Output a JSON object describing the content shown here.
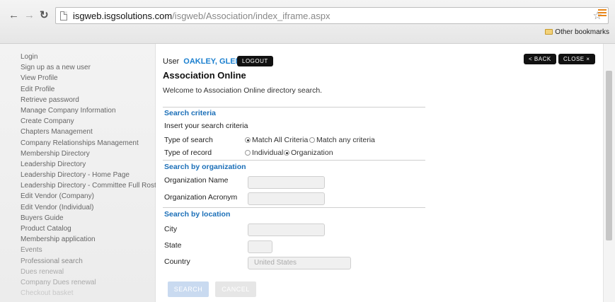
{
  "browser": {
    "url_host": "isgweb.isgsolutions.com",
    "url_path": "/isgweb/Association/index_iframe.aspx",
    "bookmarks_label": "Other bookmarks",
    "icons": {
      "back": "back-arrow-icon",
      "forward": "forward-arrow-icon",
      "reload": "reload-icon",
      "page": "page-icon",
      "star": "star-icon",
      "menu": "menu-icon",
      "folder": "folder-icon"
    }
  },
  "sidebar": {
    "items": [
      {
        "label": "Login"
      },
      {
        "label": "Sign up as a new user"
      },
      {
        "label": "View Profile"
      },
      {
        "label": "Edit Profile"
      },
      {
        "label": "Retrieve password"
      },
      {
        "label": "Manage Company Information"
      },
      {
        "label": "Create Company"
      },
      {
        "label": "Chapters Management"
      },
      {
        "label": "Company Relationships Management"
      },
      {
        "label": "Membership Directory"
      },
      {
        "label": "Leadership Directory"
      },
      {
        "label": "Leadership Directory - Home Page"
      },
      {
        "label": "Leadership Directory - Committee Full Roster"
      },
      {
        "label": "Edit Vendor (Company)"
      },
      {
        "label": "Edit Vendor (Individual)"
      },
      {
        "label": "Buyers Guide"
      },
      {
        "label": "Product Catalog"
      },
      {
        "label": "Membership application"
      },
      {
        "label": "Events"
      },
      {
        "label": "Professional search"
      },
      {
        "label": "Dues renewal"
      },
      {
        "label": "Company Dues renewal"
      },
      {
        "label": "Checkout basket"
      }
    ]
  },
  "header": {
    "user_prefix": "User",
    "user_name": "OAKLEY, GLEN",
    "logout_label": "LOGOUT",
    "back_label": "< BACK",
    "close_label": "CLOSE ×"
  },
  "page": {
    "title": "Association Online",
    "welcome": "Welcome to Association Online directory search."
  },
  "search_criteria": {
    "heading": "Search criteria",
    "instruction": "Insert your search criteria",
    "type_of_search_label": "Type of search",
    "type_of_search_options": [
      "Match All Criteria",
      "Match any criteria"
    ],
    "type_of_search_selected": "Match All Criteria",
    "type_of_record_label": "Type of record",
    "type_of_record_options": [
      "Individual",
      "Organization"
    ],
    "type_of_record_selected": "Organization"
  },
  "organization": {
    "heading": "Search by organization",
    "name_label": "Organization Name",
    "acronym_label": "Organization Acronym"
  },
  "location": {
    "heading": "Search by location",
    "city_label": "City",
    "state_label": "State",
    "country_label": "Country",
    "country_value": "United States"
  },
  "actions": {
    "search_label": "SEARCH",
    "cancel_label": "CANCEL"
  },
  "colors": {
    "accent": "#1a7fcf",
    "section_heading": "#1b6fb8",
    "dark_button": "#111111",
    "search_button": "#c9daf0"
  }
}
